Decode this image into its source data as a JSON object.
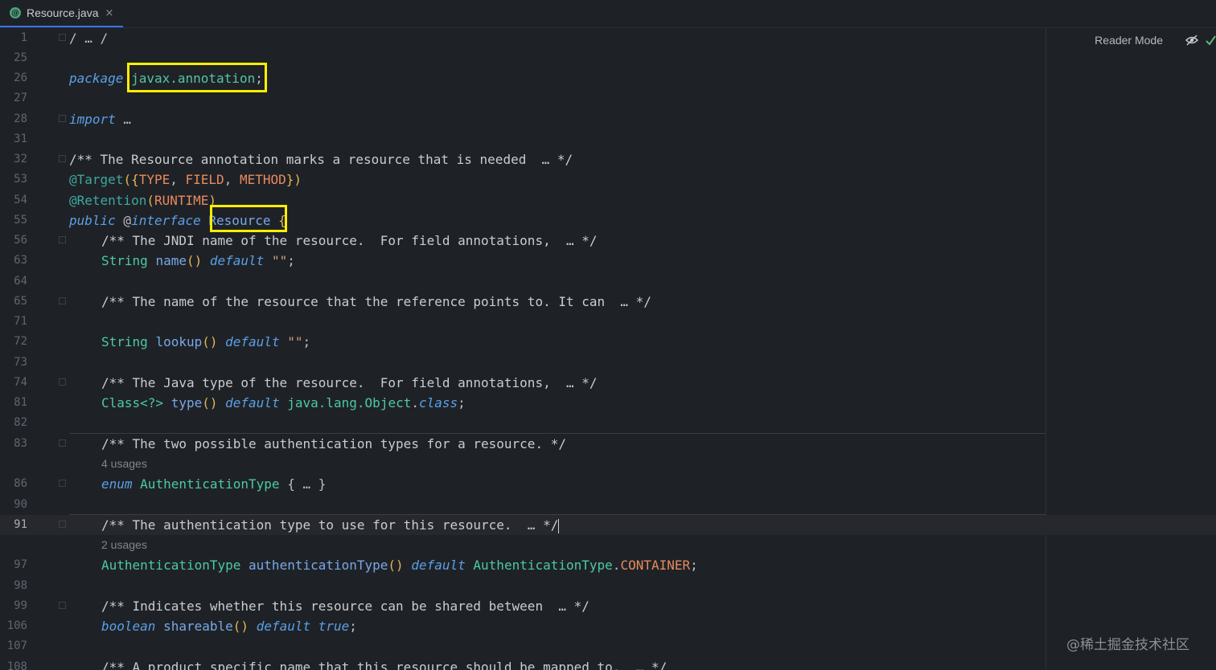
{
  "tab": {
    "title": "Resource.java",
    "close": "×",
    "icon": "java-class-icon"
  },
  "toolbar": {
    "reader_mode": "Reader Mode",
    "icons": [
      "eye-hidden-icon",
      "checkmark-icon"
    ]
  },
  "watermark": "@稀土掘金技术社区",
  "lines": {
    "l1": "1",
    "l25": "25",
    "l26": "26",
    "l27": "27",
    "l28": "28",
    "l31": "31",
    "l32": "32",
    "l53": "53",
    "l54": "54",
    "l55": "55",
    "l56": "56",
    "l63": "63",
    "l64": "64",
    "l65": "65",
    "l71": "71",
    "l72": "72",
    "l73": "73",
    "l74": "74",
    "l81": "81",
    "l82": "82",
    "l83": "83",
    "l86": "86",
    "l90": "90",
    "l91": "91",
    "l97": "97",
    "l98": "98",
    "l99": "99",
    "l106": "106",
    "l107": "107",
    "l108": "108"
  },
  "code": {
    "l1": "/ … /",
    "l26": {
      "kw": "package",
      "name": "javax.annotation",
      "semi": ";"
    },
    "l28": {
      "kw": "import",
      "rest": " …"
    },
    "l32": "/** The Resource annotation marks a resource that is needed  … */",
    "l53": {
      "ann": "@Target",
      "open": "(",
      "brace_open": "{",
      "a": "TYPE",
      "c1": ", ",
      "b": "FIELD",
      "c2": ", ",
      "c": "METHOD",
      "brace_close": "}",
      "close": ")"
    },
    "l54": {
      "ann": "@Retention",
      "open": "(",
      "a": "RUNTIME",
      "close": ")"
    },
    "l55": {
      "kw": "public",
      "at": " @",
      "kw2": "interface",
      "sp": " ",
      "name": "Resource",
      "brace": " {"
    },
    "l56": "/** The JNDI name of the resource.  For field annotations,  … */",
    "l63": {
      "type": "String",
      "sp": " ",
      "fn": "name",
      "paren": "()",
      "sp2": " ",
      "kw": "default",
      "sp3": " ",
      "val": "\"\"",
      "semi": ";"
    },
    "l65": "/** The name of the resource that the reference points to. It can  … */",
    "l72": {
      "type": "String",
      "sp": " ",
      "fn": "lookup",
      "paren": "()",
      "sp2": " ",
      "kw": "default",
      "sp3": " ",
      "val": "\"\"",
      "semi": ";"
    },
    "l74": "/** The Java type of the resource.  For field annotations,  … */",
    "l81": {
      "type": "Class<?>",
      "sp": " ",
      "fn": "type",
      "paren": "()",
      "sp2": " ",
      "kw": "default",
      "sp3": " ",
      "val": "java.lang.Object",
      "dot": ".",
      "cls": "class",
      "semi": ";"
    },
    "l83": "/** The two possible authentication types for a resource. */",
    "hint83": "4 usages",
    "l86": {
      "kw": "enum",
      "sp": " ",
      "name": "AuthenticationType",
      "rest": " { … }"
    },
    "l91": "/** The authentication type to use for this resource.  … */",
    "hint91": "2 usages",
    "l97": {
      "type": "AuthenticationType",
      "sp": " ",
      "fn": "authenticationType",
      "paren": "()",
      "sp2": " ",
      "kw": "default",
      "sp3": " ",
      "val": "AuthenticationType",
      "dot": ".",
      "en": "CONTAINER",
      "semi": ";"
    },
    "l99": "/** Indicates whether this resource can be shared between  … */",
    "l106": {
      "kw": "boolean",
      "sp": " ",
      "fn": "shareable",
      "paren": "()",
      "sp2": " ",
      "kw2": "default",
      "sp3": " ",
      "val": "true",
      "semi": ";"
    },
    "l108": "/** A product specific name that this resource should be mapped to.  … */"
  }
}
